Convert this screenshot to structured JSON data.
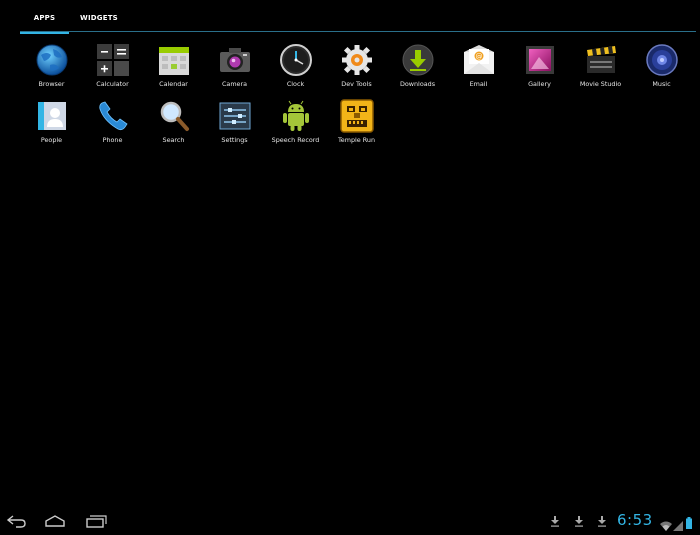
{
  "tabs": {
    "apps": "APPS",
    "widgets": "WIDGETS"
  },
  "apps": {
    "browser": "Browser",
    "calculator": "Calculator",
    "calendar": "Calendar",
    "camera": "Camera",
    "clock": "Clock",
    "devtools": "Dev Tools",
    "downloads": "Downloads",
    "email": "Email",
    "gallery": "Gallery",
    "moviestudio": "Movie Studio",
    "music": "Music",
    "people": "People",
    "phone": "Phone",
    "search": "Search",
    "settings": "Settings",
    "speechrecorder": "Speech Record",
    "templerun": "Temple Run"
  },
  "status": {
    "time": "6:53"
  },
  "colors": {
    "accent": "#33b5e5",
    "background": "#000000"
  }
}
